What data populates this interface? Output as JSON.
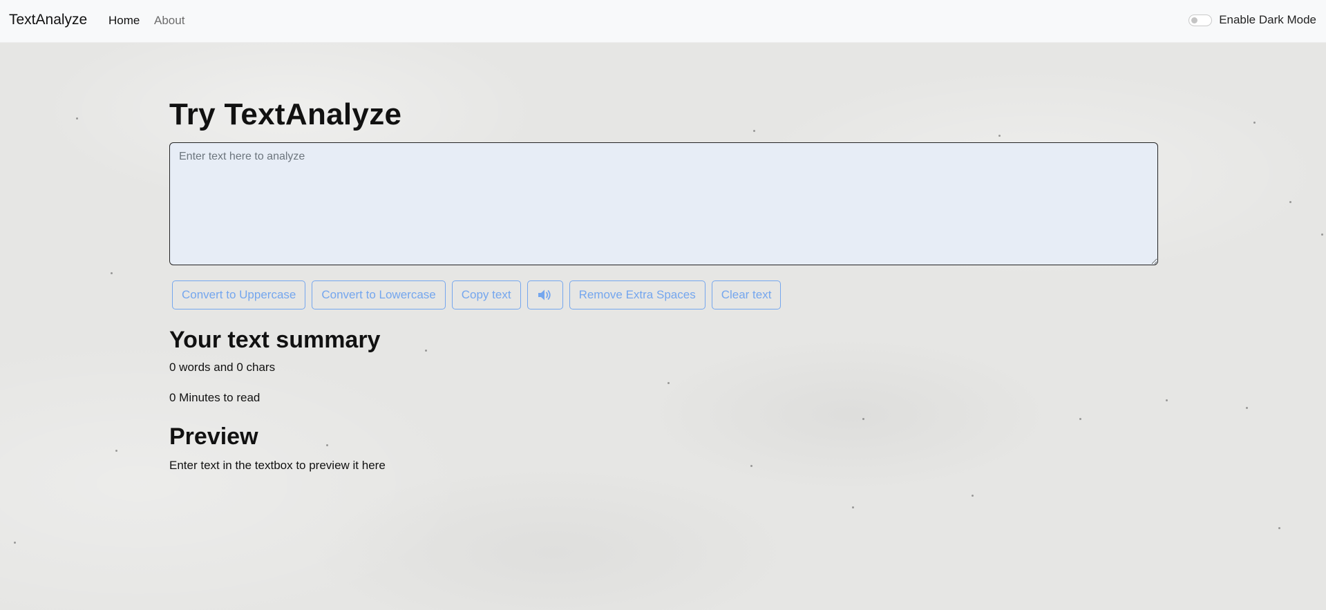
{
  "navbar": {
    "brand": "TextAnalyze",
    "links": [
      {
        "label": "Home",
        "active": true
      },
      {
        "label": "About",
        "active": false
      }
    ],
    "dark_mode_label": "Enable Dark Mode",
    "dark_mode_enabled": false
  },
  "main": {
    "heading": "Try TextAnalyze",
    "textarea": {
      "placeholder": "Enter text here to analyze",
      "value": ""
    },
    "buttons": [
      {
        "label": "Convert to Uppercase"
      },
      {
        "label": "Convert to Lowercase"
      },
      {
        "label": "Copy text"
      },
      {
        "label": "",
        "icon": "speaker-icon"
      },
      {
        "label": "Remove Extra Spaces"
      },
      {
        "label": "Clear text"
      }
    ],
    "summary": {
      "heading": "Your text summary",
      "counts": "0 words and 0 chars",
      "read_time": "0 Minutes to read"
    },
    "preview": {
      "heading": "Preview",
      "text": "Enter text in the textbox to preview it here"
    }
  },
  "colors": {
    "navbar_bg": "#f8f9fa",
    "textarea_bg": "#e7edf6",
    "button_outline": "#74a6ee",
    "background": "#e6e6e4"
  }
}
